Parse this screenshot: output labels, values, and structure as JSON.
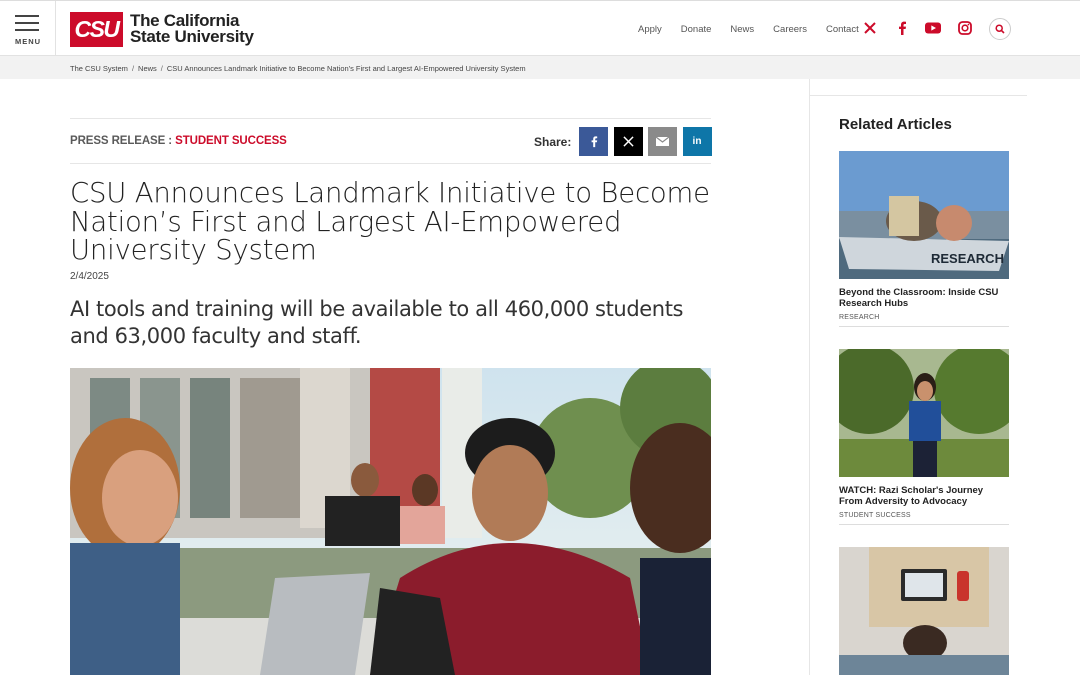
{
  "header": {
    "menu_label": "MENU",
    "logo_abbr": "CSU",
    "logo_line1": "The California",
    "logo_line2": "State University",
    "nav": [
      "Apply",
      "Donate",
      "News",
      "Careers",
      "Contact"
    ],
    "social_icons": [
      "x-icon",
      "facebook-icon",
      "youtube-icon",
      "instagram-icon"
    ],
    "accent": "#cc0b2a"
  },
  "breadcrumb": {
    "items": [
      "The CSU System",
      "News",
      "CSU Announces Landmark Initiative to Become Nation's First and Largest AI-Empowered University System"
    ],
    "separator": "/"
  },
  "article": {
    "press_label": "PRESS RELEASE :",
    "category": "STUDENT SUCCESS",
    "share_label": "Share:",
    "share_buttons": [
      {
        "icon": "facebook-icon",
        "glyph": "f",
        "color": "#3b5998"
      },
      {
        "icon": "x-icon",
        "glyph": "𝕏",
        "color": "#000000"
      },
      {
        "icon": "email-icon",
        "glyph": "✉",
        "color": "#8a8a8a"
      },
      {
        "icon": "linkedin-icon",
        "glyph": "in",
        "color": "#0e76a8"
      }
    ],
    "headline": "CSU Announces Landmark Initiative to Become Nation’s First and Largest AI-Empowered University System",
    "date": "2/4/2025",
    "subhead": "AI tools and training will be available to all 460,000 students and 63,000 faculty and staff."
  },
  "sidebar": {
    "title": "Related Articles",
    "cards": [
      {
        "title": "Beyond the Classroom: Inside CSU Research Hubs",
        "tag": "RESEARCH",
        "boat_text": "RESEARCH"
      },
      {
        "title": "WATCH: Razi Scholar's Journey From Adversity to Advocacy",
        "tag": "STUDENT SUCCESS"
      },
      {
        "title": "",
        "tag": ""
      }
    ]
  }
}
